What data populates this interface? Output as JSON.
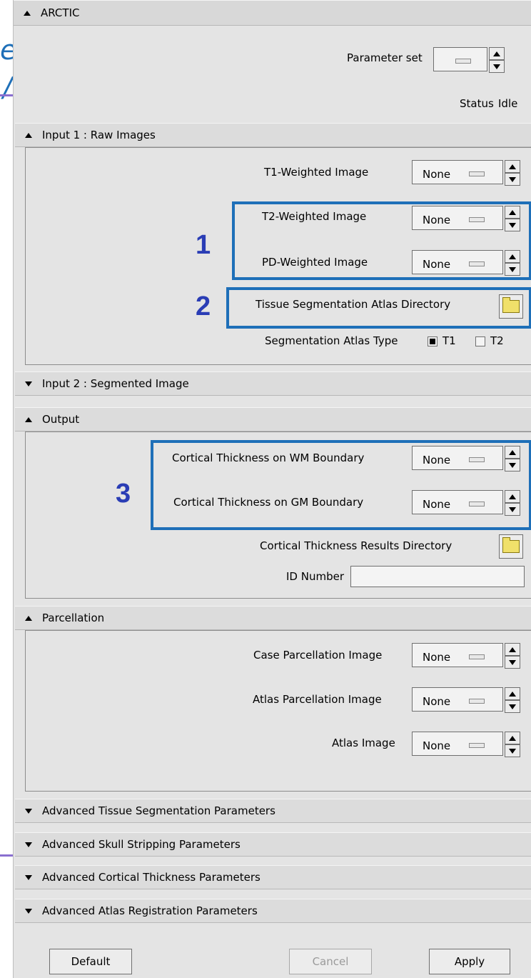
{
  "slide": {
    "fragment_top": "es”",
    "fragment_bottom": "/"
  },
  "header": {
    "title": "ARCTIC"
  },
  "top": {
    "parameter_set_label": "Parameter set",
    "status_label": "Status",
    "status_value": "Idle"
  },
  "input1": {
    "title": "Input 1 : Raw Images",
    "t1_label": "T1-Weighted Image",
    "t2_label": "T2-Weighted Image",
    "pd_label": "PD-Weighted Image",
    "atlas_dir_label": "Tissue Segmentation Atlas Directory",
    "atlas_type_label": "Segmentation Atlas Type",
    "opt_t1": "T1",
    "opt_t2": "T2"
  },
  "input2": {
    "title": "Input 2 : Segmented Image"
  },
  "output": {
    "title": "Output",
    "wm_label": "Cortical Thickness on WM Boundary",
    "gm_label": "Cortical Thickness on GM Boundary",
    "results_dir_label": "Cortical Thickness Results Directory",
    "id_label": "ID Number",
    "id_value": ""
  },
  "parcellation": {
    "title": "Parcellation",
    "case_label": "Case Parcellation Image",
    "atlas_parc_label": "Atlas Parcellation Image",
    "atlas_image_label": "Atlas Image"
  },
  "advanced": {
    "tissue": "Advanced Tissue Segmentation Parameters",
    "skull": "Advanced Skull Stripping Parameters",
    "cortical": "Advanced Cortical Thickness Parameters",
    "registration": "Advanced Atlas Registration Parameters"
  },
  "combo_value": "None",
  "annotations": {
    "one": "1",
    "two": "2",
    "three": "3"
  },
  "buttons": {
    "default": "Default",
    "cancel": "Cancel",
    "apply": "Apply"
  },
  "colors": {
    "highlight": "#1e6fb8",
    "number": "#2a3db5",
    "panel": "#e4e4e4"
  },
  "state": {
    "atlas_type_selected": "T1"
  }
}
